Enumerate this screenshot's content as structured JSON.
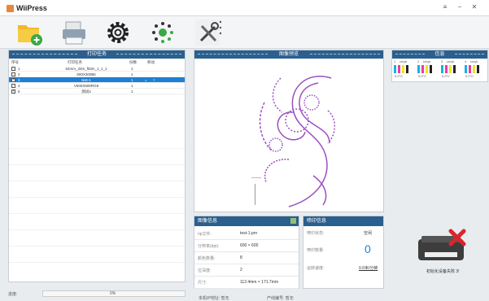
{
  "window": {
    "title": "WiiPress",
    "min": "−",
    "max": "□",
    "close": "✕",
    "menu": "≡"
  },
  "toolbar": {
    "items": [
      "add-file",
      "printer",
      "settings",
      "loading",
      "tools"
    ]
  },
  "tasks": {
    "title": "打印任务",
    "headers": {
      "seq": "序号",
      "name": "打印任务",
      "count": "份数",
      "move": "移动"
    },
    "rows": [
      {
        "seq": "1",
        "name": "54mm_33m_fbitm_1_1_1",
        "count": "1",
        "checked": false,
        "selected": false
      },
      {
        "seq": "2",
        "name": "600X300Bit",
        "count": "1",
        "checked": false,
        "selected": false
      },
      {
        "seq": "3",
        "name": "test-1",
        "count": "1",
        "checked": true,
        "selected": true
      },
      {
        "seq": "4",
        "name": "V600X600RG8",
        "count": "1",
        "checked": false,
        "selected": false
      },
      {
        "seq": "5",
        "name": "测试4",
        "count": "1",
        "checked": true,
        "selected": false
      }
    ]
  },
  "preview": {
    "title": "图像预览"
  },
  "info": {
    "title": "信息",
    "inks": [
      {
        "label": "1",
        "sub": "cmyk",
        "temp": "0.0°C"
      },
      {
        "label": "2",
        "sub": "cmyk",
        "temp": "0.0°C"
      },
      {
        "label": "3",
        "sub": "cmyk",
        "temp": "0.0°C"
      },
      {
        "label": "4",
        "sub": "cmyk",
        "temp": "0.0°C"
      }
    ]
  },
  "image_info": {
    "title": "图像信息",
    "rows": [
      {
        "k": "rip文件:",
        "v": "test-1.prn"
      },
      {
        "k": "分辨率(dpi):",
        "v": "600 × 600"
      },
      {
        "k": "颜色数量:",
        "v": "8"
      },
      {
        "k": "位深度:",
        "v": "2"
      },
      {
        "k": "尺寸:",
        "v": "112.4mm × 171.7mm"
      }
    ]
  },
  "print_info": {
    "title": "喷印信息",
    "state_k": "喷印状态:",
    "state_v": "空闲",
    "count_k": "喷印数量:",
    "count_v": "0",
    "speed_k": "运转速度:",
    "speed_v": "0.0米/分钟"
  },
  "device": {
    "status": "初始化设备失败 3!"
  },
  "statusbar": {
    "progress_label": "进度:",
    "progress": "0%",
    "bottom_left": "本机IP地址: 暂无",
    "bottom_right": "产线编号: 暂无"
  }
}
